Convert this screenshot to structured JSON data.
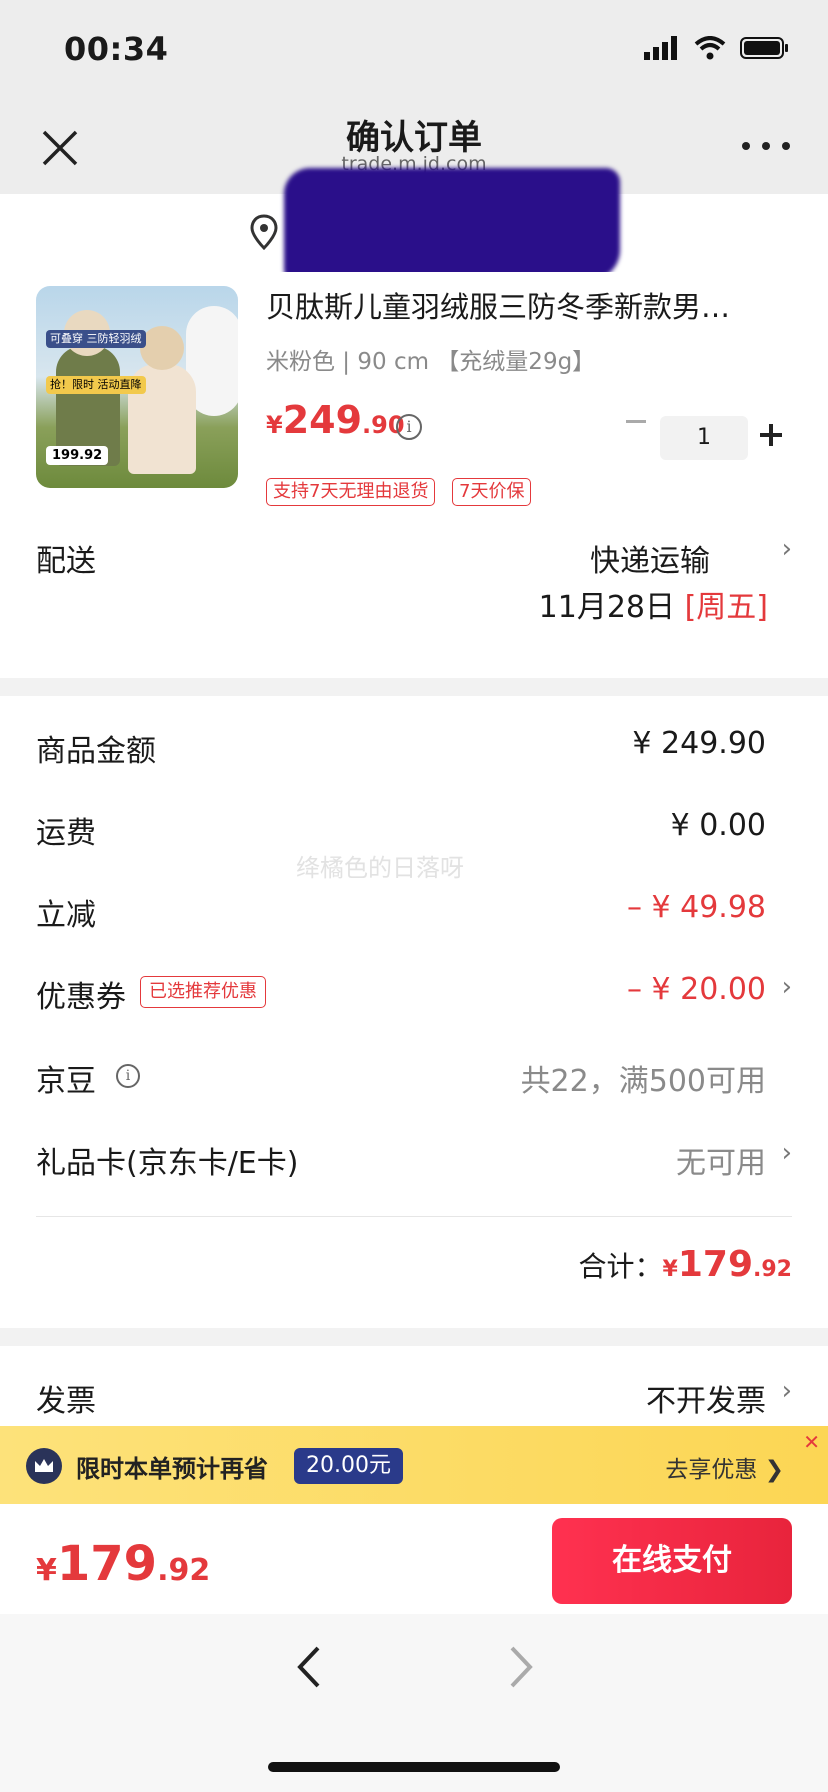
{
  "status": {
    "time": "00:34"
  },
  "nav": {
    "title": "确认订单",
    "subtitle": "trade.m.jd.com"
  },
  "product": {
    "title": "贝肽斯儿童羽绒服三防冬季新款男…",
    "spec": "米粉色 | 90 cm 【充绒量29g】",
    "price_symbol": "¥",
    "price_int": "249",
    "price_dec": ".90",
    "quantity": "1",
    "badges": [
      "支持7天无理由退货",
      "7天价保"
    ],
    "image_text": {
      "tag1": "可叠穿 三防轻羽绒",
      "tag2": "抢！限时 活动直降",
      "price": "199.92"
    }
  },
  "delivery": {
    "label": "配送",
    "method": "快递运输",
    "date": "11月28日",
    "weekday": "[周五]"
  },
  "summary": {
    "goods_label": "商品金额",
    "goods_value": "¥ 249.90",
    "shipping_label": "运费",
    "shipping_value": "¥ 0.00",
    "discount_label": "立减",
    "discount_value": "– ¥ 49.98",
    "coupon_label": "优惠券",
    "coupon_tag": "已选推荐优惠",
    "coupon_value": "– ¥ 20.00",
    "jd_bean_label": "京豆",
    "jd_bean_value": "共22，满500可用",
    "gift_card_label": "礼品卡(京东卡/E卡)",
    "gift_card_value": "无可用",
    "total_label": "合计：",
    "total_symbol": "¥",
    "total_int": "179",
    "total_dec": ".92"
  },
  "watermark": "绛橘色的日落呀",
  "invoice": {
    "label": "发票",
    "value": "不开发票"
  },
  "promo": {
    "text": "限时本单预计再省",
    "amount": "20.00元",
    "action": "去享优惠 ❯",
    "close": "✕"
  },
  "pay": {
    "symbol": "¥",
    "int": "179",
    "dec": ".92",
    "button": "在线支付"
  },
  "colors": {
    "accent": "#e4393c",
    "promo_bg": "#fcd654",
    "pay_button": "#ff3150"
  }
}
